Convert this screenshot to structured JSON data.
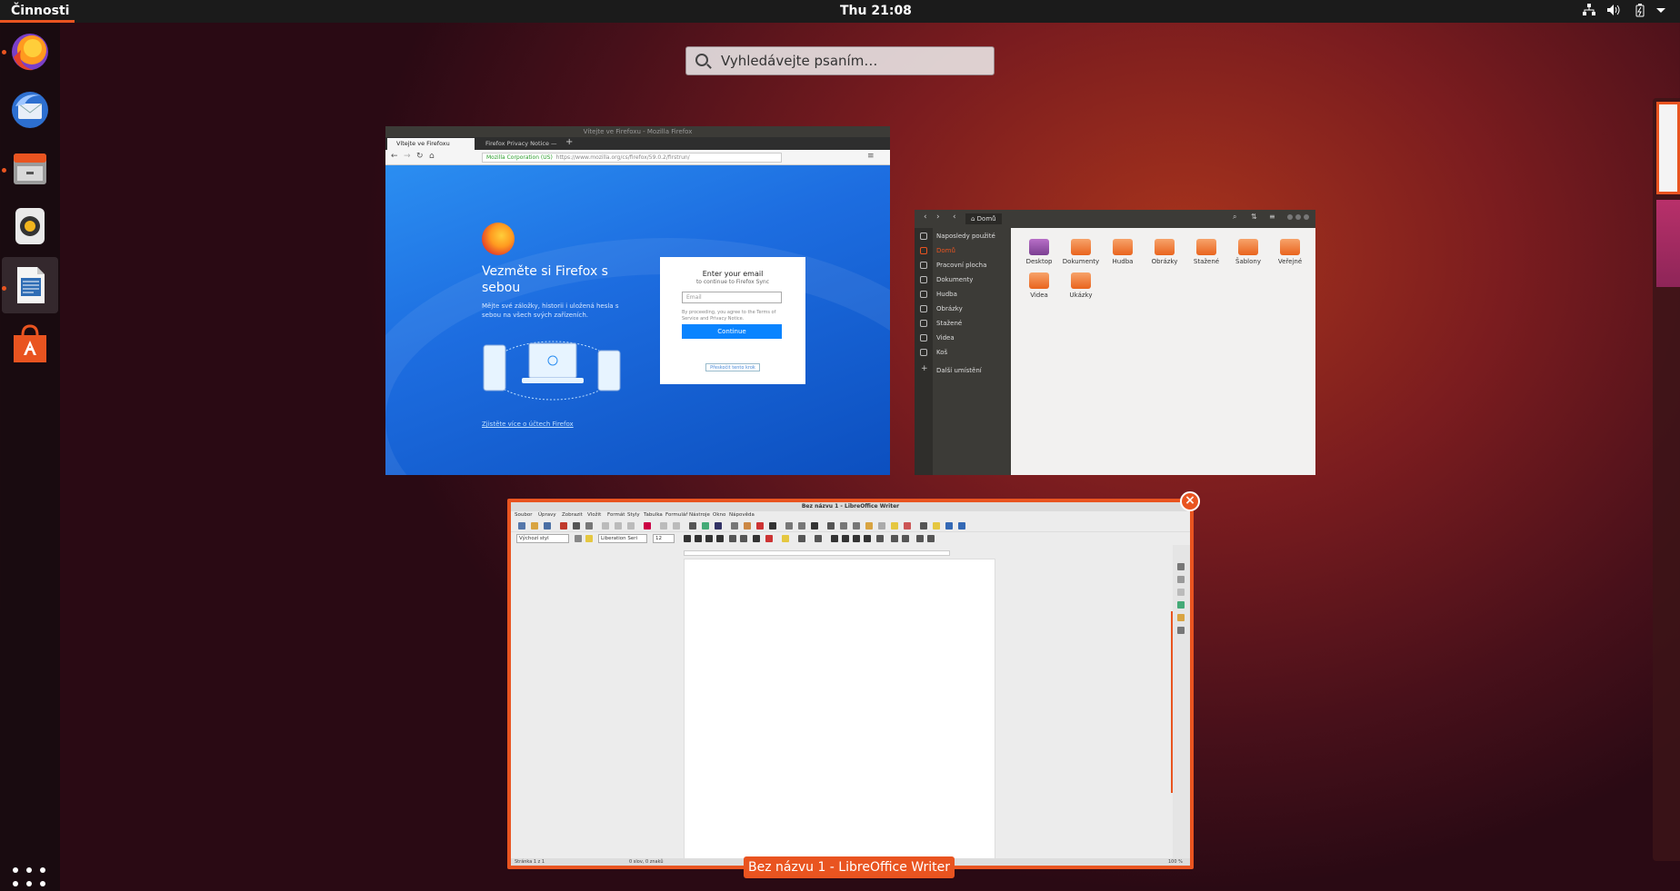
{
  "topbar": {
    "activities": "Činnosti",
    "clock": "Thu 21:08",
    "tray": [
      "network-icon",
      "volume-icon",
      "battery-icon",
      "menu-arrow-icon"
    ]
  },
  "search": {
    "placeholder": "Vyhledávejte psaním…"
  },
  "dock": {
    "apps": [
      "Firefox",
      "Thunderbird",
      "Soubory",
      "Rhythmbox",
      "LibreOffice Writer",
      "Ubuntu Software"
    ],
    "running": [
      0,
      2,
      4
    ]
  },
  "firefox": {
    "title": "Vítejte ve Firefoxu - Mozilla Firefox",
    "tabs": [
      "Vítejte ve Firefoxu",
      "Firefox Privacy Notice —"
    ],
    "url_identity": "Mozilla Corporation (US)",
    "url": "https://www.mozilla.org/cs/firefox/59.0.2/firstrun/",
    "heading": "Vezměte si Firefox s sebou",
    "subtext": "Mějte své záložky, historii i uložená hesla s sebou na všech svých zařízeních.",
    "learn_more": "Zjistěte více o účtech Firefox",
    "card": {
      "title": "Enter your email",
      "subtitle": "to continue to Firefox Sync",
      "email_placeholder": "Email",
      "terms": "By proceeding, you agree to the Terms of Service and Privacy Notice.",
      "continue": "Continue",
      "passwordless": "Přeskočit tento krok"
    }
  },
  "files": {
    "breadcrumb": "Domů",
    "sidebar": [
      "Naposledy použité",
      "Domů",
      "Pracovní plocha",
      "Dokumenty",
      "Hudba",
      "Obrázky",
      "Stažené",
      "Videa",
      "Koš",
      "Další umístění"
    ],
    "folders": [
      "Desktop",
      "Dokumenty",
      "Hudba",
      "Obrázky",
      "Stažené",
      "Šablony",
      "Veřejné",
      "Videa",
      "Ukázky"
    ]
  },
  "writer": {
    "title": "Bez názvu 1 - LibreOffice Writer",
    "menu": [
      "Soubor",
      "Úpravy",
      "Zobrazit",
      "Vložit",
      "Formát",
      "Styly",
      "Tabulka",
      "Formulář",
      "Nástroje",
      "Okno",
      "Nápověda"
    ],
    "paragraph_style": "Výchozí styl",
    "font": "Liberation Seri",
    "size": "12",
    "status": {
      "page": "Stránka 1 z 1",
      "words": "0 slov, 0 znaků",
      "zoom": "100 %"
    },
    "caption": "Bez názvu 1 - LibreOffice Writer"
  },
  "colors": {
    "accent": "#e95420",
    "topbar": "#1b1b1b",
    "firefox_blue": "#0a84ff"
  }
}
